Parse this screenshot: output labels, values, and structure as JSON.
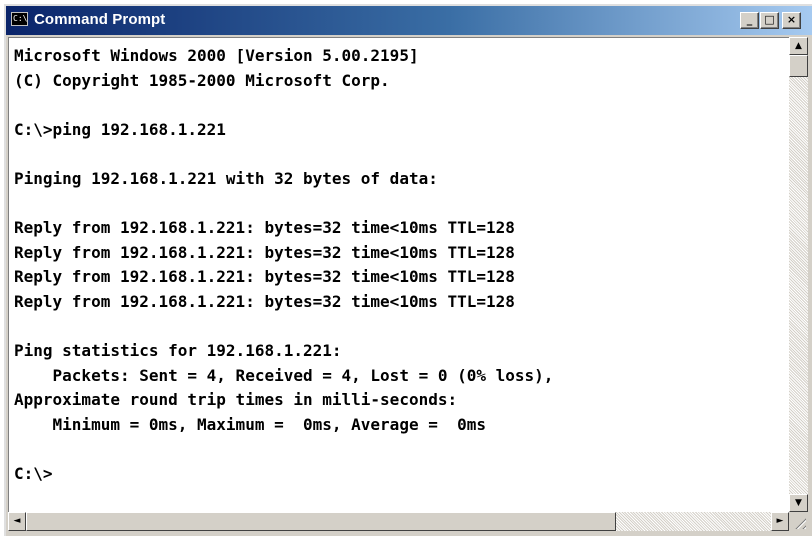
{
  "window": {
    "title": "Command Prompt",
    "icon_label": "C:\\",
    "controls": {
      "minimize": "_",
      "maximize": "□",
      "close": "×"
    }
  },
  "console": {
    "lines": [
      "Microsoft Windows 2000 [Version 5.00.2195]",
      "(C) Copyright 1985-2000 Microsoft Corp.",
      "",
      "C:\\>ping 192.168.1.221",
      "",
      "Pinging 192.168.1.221 with 32 bytes of data:",
      "",
      "Reply from 192.168.1.221: bytes=32 time<10ms TTL=128",
      "Reply from 192.168.1.221: bytes=32 time<10ms TTL=128",
      "Reply from 192.168.1.221: bytes=32 time<10ms TTL=128",
      "Reply from 192.168.1.221: bytes=32 time<10ms TTL=128",
      "",
      "Ping statistics for 192.168.1.221:",
      "    Packets: Sent = 4, Received = 4, Lost = 0 (0% loss),",
      "Approximate round trip times in milli-seconds:",
      "    Minimum = 0ms, Maximum =  0ms, Average =  0ms",
      "",
      "C:\\>"
    ]
  },
  "scrollbars": {
    "up": "▲",
    "down": "▼",
    "left": "◄",
    "right": "►"
  },
  "colors": {
    "titlebar_start": "#0a246a",
    "titlebar_end": "#a6caf0",
    "console_bg": "#ffffff",
    "console_text": "#000000",
    "chrome": "#d4d0c8"
  }
}
